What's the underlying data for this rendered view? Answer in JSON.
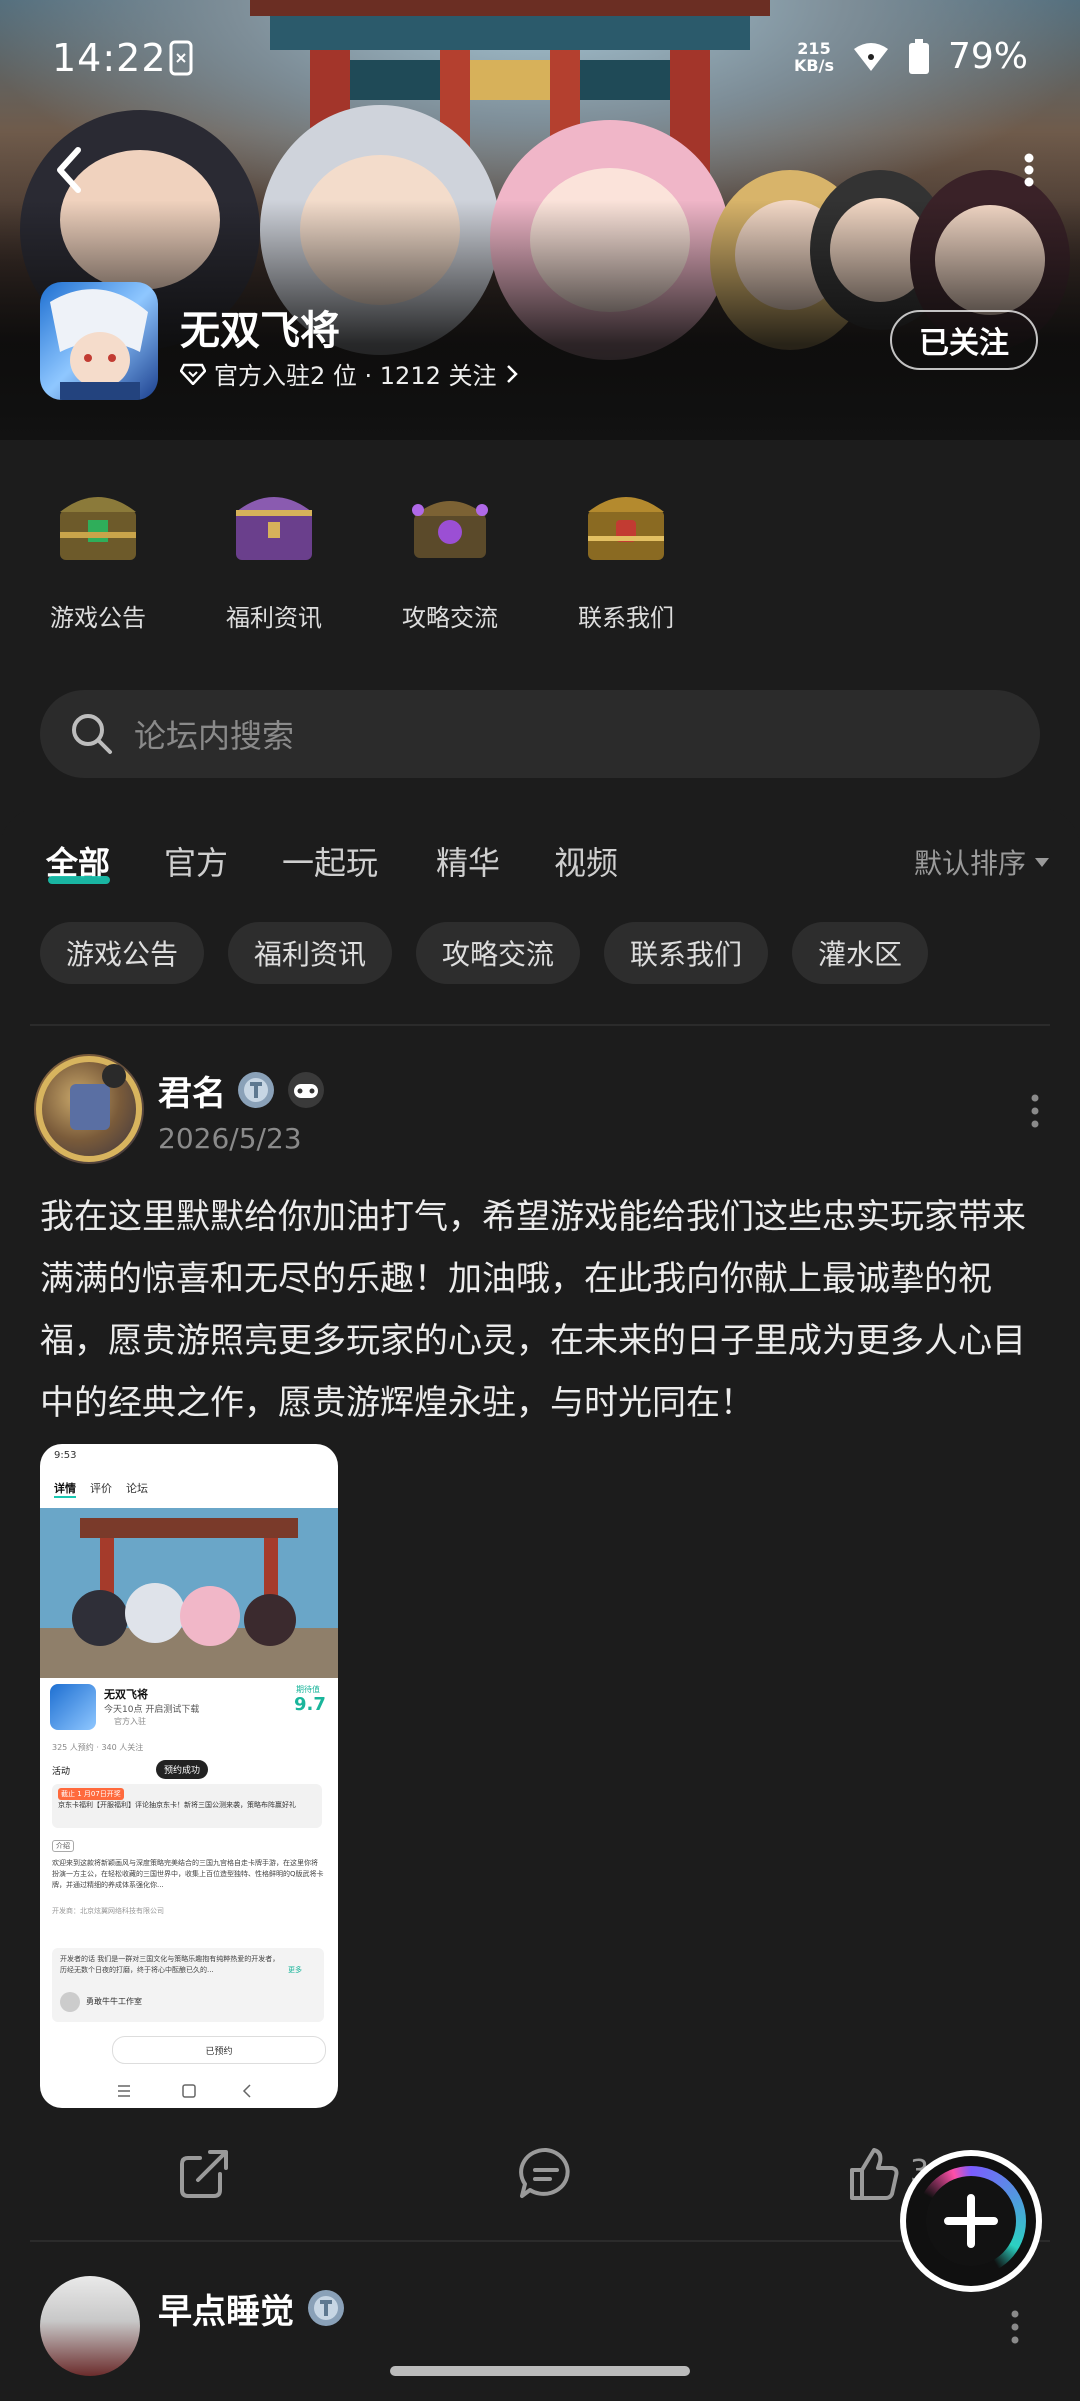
{
  "status_bar": {
    "time": "14:22",
    "net_speed_value": "215",
    "net_speed_unit": "KB/s",
    "battery": "79%"
  },
  "app": {
    "name": "无双飞将",
    "meta": "官方入驻2 位 · 1212 关注",
    "follow_label": "已关注"
  },
  "quick_links": [
    {
      "label": "游戏公告",
      "icon": "treasure-chest-icon"
    },
    {
      "label": "福利资讯",
      "icon": "treasure-chest-icon"
    },
    {
      "label": "攻略交流",
      "icon": "treasure-chest-icon"
    },
    {
      "label": "联系我们",
      "icon": "treasure-chest-icon"
    }
  ],
  "search": {
    "placeholder": "论坛内搜索"
  },
  "tabs": [
    {
      "label": "全部",
      "active": true
    },
    {
      "label": "官方"
    },
    {
      "label": "一起玩"
    },
    {
      "label": "精华"
    },
    {
      "label": "视频"
    }
  ],
  "sort_label": "默认排序",
  "chips": [
    "游戏公告",
    "福利资讯",
    "攻略交流",
    "联系我们",
    "灌水区"
  ],
  "post": {
    "author": "君名",
    "date": "2026/5/23",
    "content": "我在这里默默给你加油打气，希望游戏能给我们这些忠实玩家带来满满的惊喜和无尽的乐趣！加油哦，在此我向你献上最诚挚的祝福，愿贵游照亮更多玩家的心灵，在未来的日子里成为更多人心目中的经典之作，愿贵游辉煌永驻，与时光同在！",
    "likes": "3",
    "screenshot": {
      "time": "9:53",
      "tabs": [
        "详情",
        "评价",
        "论坛"
      ],
      "app_name": "无双飞将",
      "app_sub": "今天10点 开启测试下载",
      "official": "官方入驻",
      "score_label": "期待值",
      "score": "9.7",
      "stats": "325 人预约  · 340 人关注",
      "activity": "活动",
      "toast": "预约成功",
      "banner_tag": "截止 1 月07日开奖",
      "banner_text": "京东卡福利【开服福利】评论抽京东卡！新将三国公测来袭，策略布阵赢好礼",
      "intro_tag": "介绍",
      "intro_text": "欢迎来到这款将新颖画风与深度策略完美结合的三国九宫格自走卡牌手游，在这里你将扮演一方主公，在轻松收藏的三国世界中，收集上百位造型独特、性格鲜明的Q版武将卡牌，并通过精细的养成体系强化你...",
      "developer": "开发商：北京炫翼网络科技有限公司",
      "dev_note": "开发者的话  我们是一群对三国文化与策略乐趣抱有纯粹热爱的开发者，历经无数个日夜的打磨，终于将心中酝酿已久的...",
      "more": "更多",
      "studio": "勇敢牛牛工作室",
      "reserved": "已预约"
    }
  },
  "next_post": {
    "author": "早点睡觉"
  }
}
